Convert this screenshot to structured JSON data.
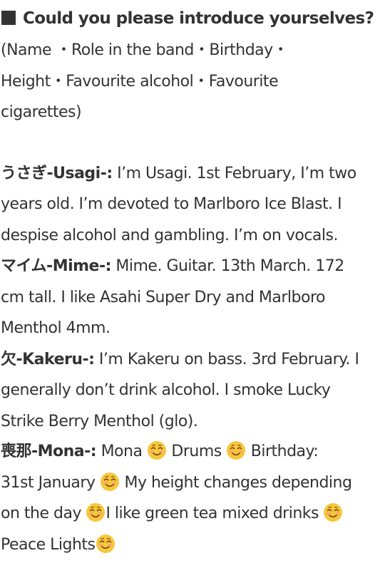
{
  "heading": {
    "text": "Could you please introduce yourselves?"
  },
  "intro_lines": [
    "(Name ・Role in the band・Birthday・",
    "Height・Favourite alcohol・Favourite",
    "cigarettes)"
  ],
  "members": {
    "usagi": {
      "name": "うさぎ-Usagi-:",
      "lines": [
        " I’m Usagi. 1st February, I’m two",
        "years old. I’m devoted to Marlboro Ice Blast. I",
        "despise alcohol and gambling. I’m on vocals."
      ]
    },
    "mime": {
      "name": "マイム-Mime-:",
      "lines": [
        " Mime. Guitar. 13th March. 172",
        "cm tall. I like Asahi Super Dry and Marlboro",
        "Menthol 4mm."
      ]
    },
    "kakeru": {
      "name": "欠-Kakeru-:",
      "lines": [
        " I’m Kakeru on bass. 3rd February. I",
        "generally don’t drink alcohol. I smoke Lucky",
        "Strike Berry Menthol (glo)."
      ]
    },
    "mona": {
      "name": "喪那-Mona-:",
      "lines": [
        [
          " Mona ",
          " Drums ",
          " Birthday:"
        ],
        [
          "31st January ",
          " My height changes depending"
        ],
        [
          "on the day ",
          "I like green tea mixed drinks ",
          ""
        ],
        [
          "Peace Lights",
          ""
        ]
      ]
    }
  },
  "emoji": {
    "name": "smiling-face-emoji",
    "face_color": "#F7C73B",
    "cheek_color": "#F4A07A",
    "feature_color": "#7A4A12"
  }
}
